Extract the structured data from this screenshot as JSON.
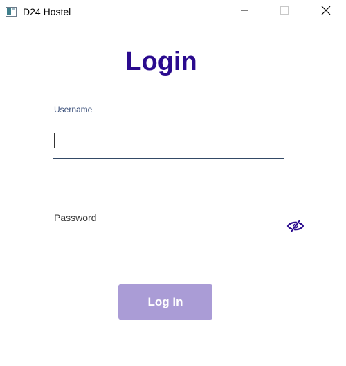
{
  "window": {
    "title": "D24 Hostel",
    "controls": {
      "minimize_icon": "minimize-icon",
      "maximize_icon": "maximize-icon",
      "close_icon": "close-icon"
    }
  },
  "login": {
    "heading": "Login",
    "username": {
      "label": "Username",
      "value": ""
    },
    "password": {
      "placeholder": "Password",
      "value": "",
      "toggle_icon": "eye-slash-icon"
    },
    "submit_label": "Log In"
  },
  "colors": {
    "heading": "#2a0a8e",
    "button": "#aa9cd6",
    "eye_icon": "#2a0a8e",
    "username_underline": "#344a66"
  }
}
